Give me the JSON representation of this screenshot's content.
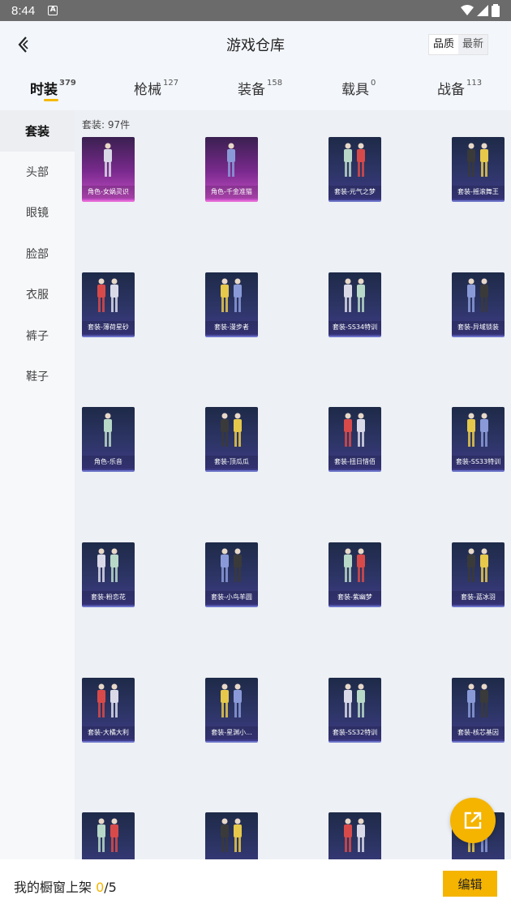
{
  "status_bar": {
    "time": "8:44",
    "notification_icon": "A"
  },
  "header": {
    "title": "游戏仓库",
    "sort_quality": "品质",
    "sort_newest": "最新"
  },
  "tabs": [
    {
      "label": "时装",
      "count": "379"
    },
    {
      "label": "枪械",
      "count": "127"
    },
    {
      "label": "装备",
      "count": "158"
    },
    {
      "label": "载具",
      "count": "0"
    },
    {
      "label": "战备",
      "count": "113"
    }
  ],
  "sidebar": [
    {
      "label": "套装"
    },
    {
      "label": "头部"
    },
    {
      "label": "眼镜"
    },
    {
      "label": "脸部"
    },
    {
      "label": "衣服"
    },
    {
      "label": "裤子"
    },
    {
      "label": "鞋子"
    }
  ],
  "count_label": "套装: 97件",
  "items": [
    {
      "label": "角色-女娲灵识",
      "rarity": "purple"
    },
    {
      "label": "角色-千金准猫",
      "rarity": "purple"
    },
    {
      "label": "套装-元气之梦",
      "rarity": "blue"
    },
    {
      "label": "套装-摇滚舞王",
      "rarity": "blue"
    },
    {
      "label": "套装-薄荷星砂",
      "rarity": "blue"
    },
    {
      "label": "套装-漫步者",
      "rarity": "blue"
    },
    {
      "label": "套装-SS34特训",
      "rarity": "blue"
    },
    {
      "label": "套装-异域锁装",
      "rarity": "blue"
    },
    {
      "label": "角色-乐音",
      "rarity": "blue"
    },
    {
      "label": "套装-顶瓜瓜",
      "rarity": "blue"
    },
    {
      "label": "套装-扭日惜佰",
      "rarity": "blue"
    },
    {
      "label": "套装-SS33特训",
      "rarity": "blue"
    },
    {
      "label": "套装-粉恋花",
      "rarity": "blue"
    },
    {
      "label": "套装-小鸟羊圆",
      "rarity": "blue"
    },
    {
      "label": "套装-紫幽梦",
      "rarity": "blue"
    },
    {
      "label": "套装-蓝冰羽",
      "rarity": "blue"
    },
    {
      "label": "套装-大橘大利",
      "rarity": "blue"
    },
    {
      "label": "套装-星渊小...",
      "rarity": "blue"
    },
    {
      "label": "套装-SS32特训",
      "rarity": "blue"
    },
    {
      "label": "套装-核芯基因",
      "rarity": "blue"
    },
    {
      "label": "",
      "rarity": "blue"
    },
    {
      "label": "",
      "rarity": "blue"
    },
    {
      "label": "",
      "rarity": "blue"
    },
    {
      "label": "",
      "rarity": "blue"
    }
  ],
  "bottom_bar": {
    "prefix": "我的橱窗上架 ",
    "used": "0",
    "separator": "/",
    "total": "5",
    "edit_label": "编辑"
  },
  "colors": {
    "accent": "#f5b400",
    "purple_card": "#7a2a8e",
    "blue_card": "#2d3566"
  }
}
